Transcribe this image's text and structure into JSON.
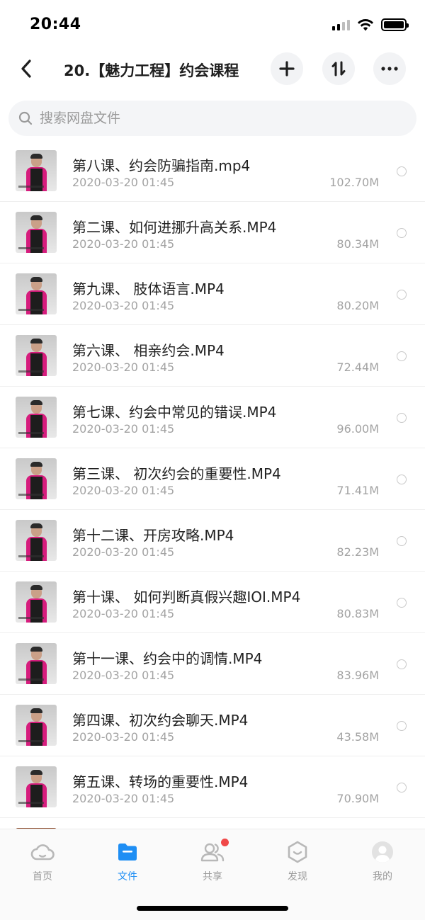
{
  "status_bar": {
    "time": "20:44",
    "battery_level": 1.0
  },
  "nav": {
    "title": "20.【魅力工程】约会课程",
    "icons": {
      "back": "back-icon",
      "add": "plus-icon",
      "sort": "sort-icon",
      "more": "more-icon"
    }
  },
  "search": {
    "placeholder": "搜索网盘文件",
    "value": ""
  },
  "files": [
    {
      "name": "第八课、约会防骗指南.mp4",
      "date": "2020-03-20 01:45",
      "size": "102.70M"
    },
    {
      "name": "第二课、如何进挪升高关系.MP4",
      "date": "2020-03-20 01:45",
      "size": "80.34M"
    },
    {
      "name": "第九课、 肢体语言.MP4",
      "date": "2020-03-20 01:45",
      "size": "80.20M"
    },
    {
      "name": "第六课、 相亲约会.MP4",
      "date": "2020-03-20 01:45",
      "size": "72.44M"
    },
    {
      "name": "第七课、约会中常见的错误.MP4",
      "date": "2020-03-20 01:45",
      "size": "96.00M"
    },
    {
      "name": "第三课、 初次约会的重要性.MP4",
      "date": "2020-03-20 01:45",
      "size": "71.41M"
    },
    {
      "name": "第十二课、开房攻略.MP4",
      "date": "2020-03-20 01:45",
      "size": "82.23M"
    },
    {
      "name": "第十课、 如何判断真假兴趣IOI.MP4",
      "date": "2020-03-20 01:45",
      "size": "80.83M"
    },
    {
      "name": "第十一课、约会中的调情.MP4",
      "date": "2020-03-20 01:45",
      "size": "83.96M"
    },
    {
      "name": "第四课、初次约会聊天.MP4",
      "date": "2020-03-20 01:45",
      "size": "43.58M"
    },
    {
      "name": "第五课、转场的重要性.MP4",
      "date": "2020-03-20 01:45",
      "size": "70.90M"
    },
    {
      "name": "",
      "date": "",
      "size": ""
    }
  ],
  "tabs": [
    {
      "label": "首页",
      "icon": "cloud-icon",
      "active": false
    },
    {
      "label": "文件",
      "icon": "folder-icon",
      "active": true
    },
    {
      "label": "共享",
      "icon": "people-icon",
      "active": false,
      "badge": true
    },
    {
      "label": "发现",
      "icon": "discover-icon",
      "active": false
    },
    {
      "label": "我的",
      "icon": "avatar-icon",
      "active": false
    }
  ],
  "colors": {
    "accent": "#1e8ef4",
    "badge": "#f04848",
    "thumb_shirt": "#d61c7d"
  }
}
